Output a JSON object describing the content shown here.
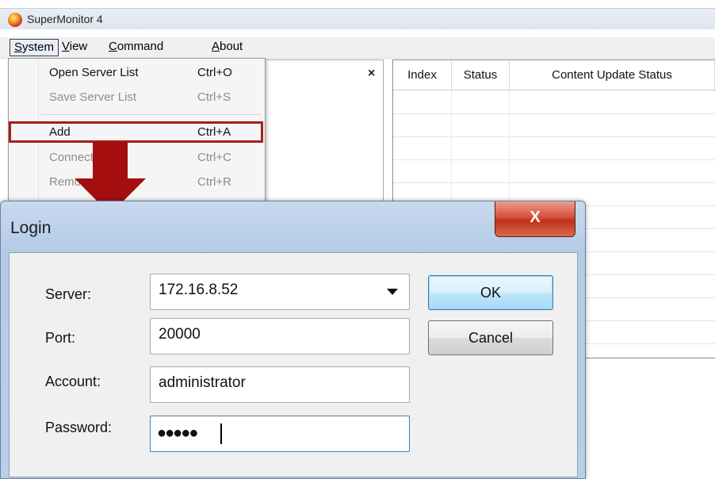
{
  "app": {
    "title": "SuperMonitor 4"
  },
  "menubar": {
    "items": [
      "System",
      "View",
      "Command",
      "About"
    ]
  },
  "left_pane": {
    "close_glyph": "×"
  },
  "grid": {
    "columns": [
      "Index",
      "Status",
      "Content Update Status"
    ]
  },
  "system_menu": {
    "items": [
      {
        "label": "Open Server List",
        "shortcut": "Ctrl+O",
        "enabled": true
      },
      {
        "label": "Save Server List",
        "shortcut": "Ctrl+S",
        "enabled": false
      },
      {
        "label": "Add",
        "shortcut": "Ctrl+A",
        "enabled": true,
        "highlighted": true
      },
      {
        "label": "Connect",
        "shortcut": "Ctrl+C",
        "enabled": false
      },
      {
        "label": "Remove",
        "shortcut": "Ctrl+R",
        "enabled": false
      }
    ]
  },
  "annotation": {
    "color": "#a40e0e",
    "icon": "down-arrow-icon"
  },
  "dialog": {
    "title": "Login",
    "close_glyph": "X",
    "fields": {
      "server": {
        "label": "Server:",
        "value": "172.16.8.52"
      },
      "port": {
        "label": "Port:",
        "value": "20000"
      },
      "account": {
        "label": "Account:",
        "value": "administrator"
      },
      "password": {
        "label": "Password:",
        "value": "●●●●●"
      }
    },
    "ok_label": "OK",
    "cancel_label": "Cancel"
  }
}
